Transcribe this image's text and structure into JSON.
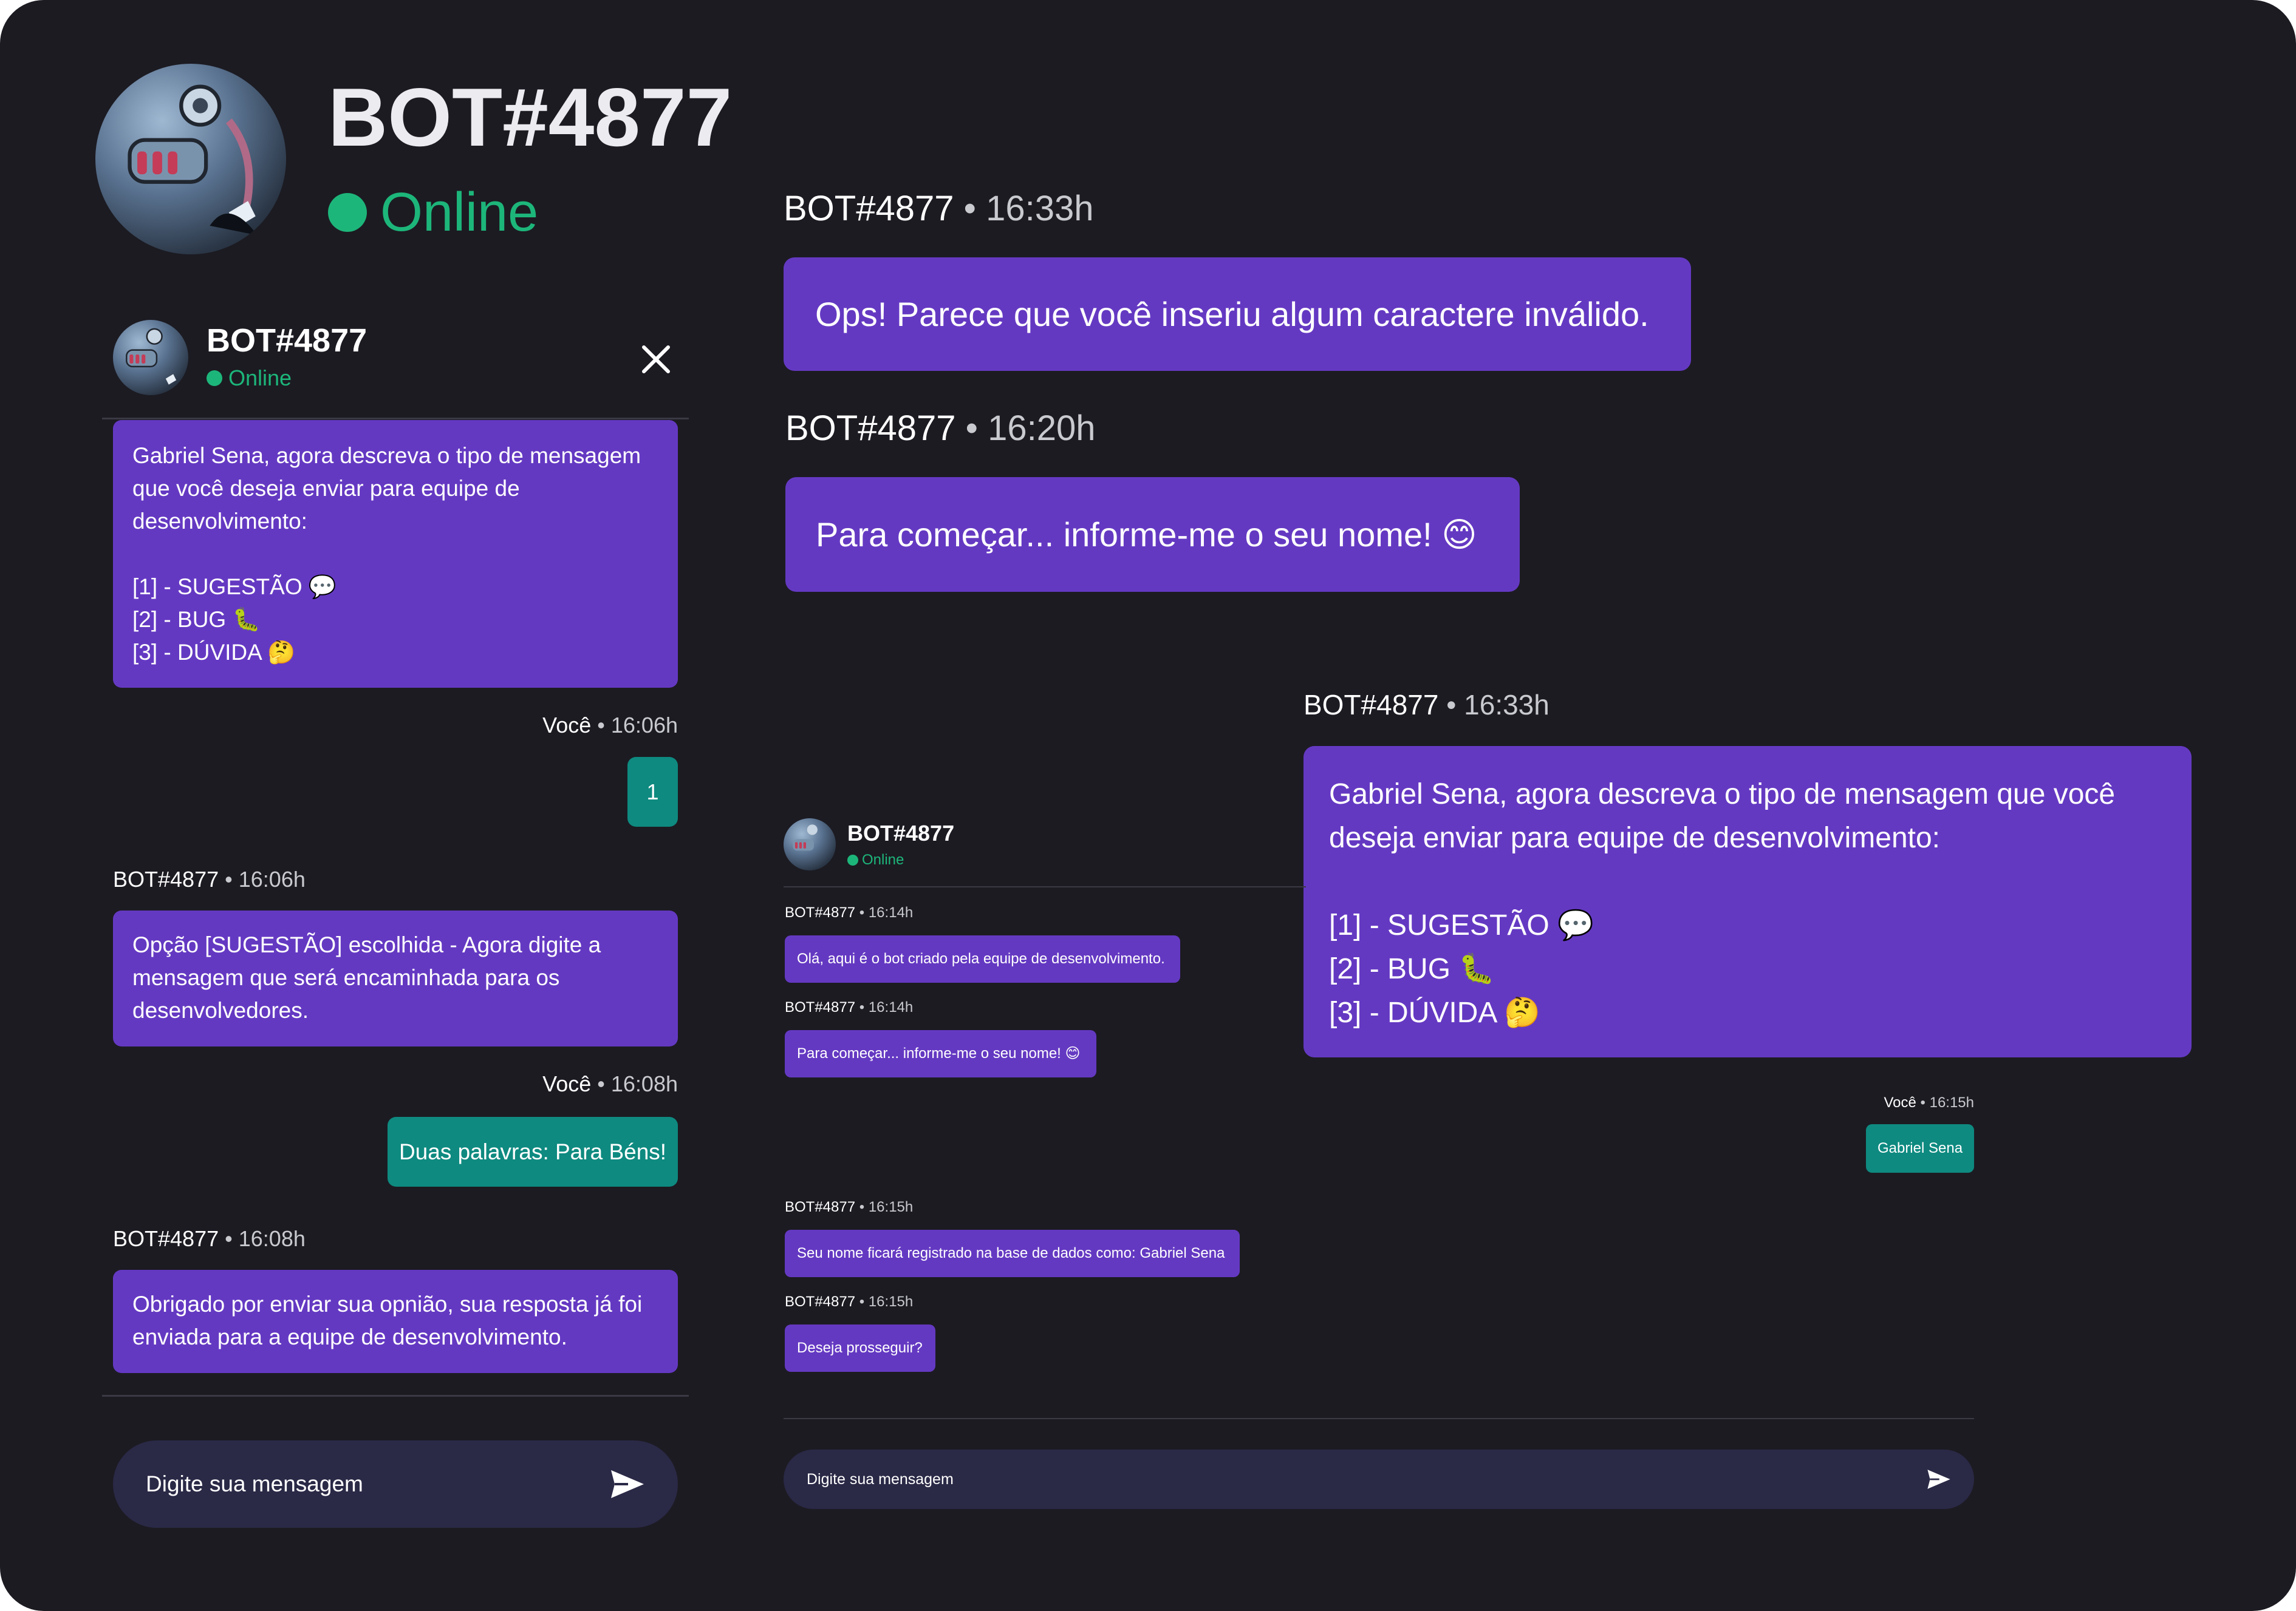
{
  "colors": {
    "background": "#1c1b22",
    "bot_bubble": "#6439c2",
    "user_bubble": "#0e8a80",
    "online": "#1db67a",
    "input": "#2a2946"
  },
  "hero": {
    "name": "BOT#4877",
    "status": "Online"
  },
  "left_chat": {
    "header": {
      "name": "BOT#4877",
      "status": "Online",
      "close_icon": "close-icon"
    },
    "messages": [
      {
        "text": "Gabriel Sena, agora descreva o tipo de mensagem que você deseja enviar para equipe de desenvolvimento:\n\n[1] - SUGESTÃO 💬\n[2] - BUG 🐛\n[3] - DÚVIDA 🤔"
      },
      {
        "sender": "Você",
        "time": "16:06h",
        "text": "1"
      },
      {
        "sender": "BOT#4877",
        "time": "16:06h",
        "text": "Opção [SUGESTÃO] escolhida - Agora digite a mensagem que será encaminhada para os desenvolvedores."
      },
      {
        "sender": "Você",
        "time": "16:08h",
        "text": "Duas palavras: Para Béns!"
      },
      {
        "sender": "BOT#4877",
        "time": "16:08h",
        "text": "Obrigado por enviar sua opnião, sua resposta já foi enviada para a equipe de desenvolvimento."
      }
    ],
    "input_placeholder": "Digite sua mensagem",
    "send_icon": "send-icon"
  },
  "showcase": [
    {
      "sender": "BOT#4877",
      "time": "16:33h",
      "text": "Ops! Parece que você inseriu algum caractere inválido."
    },
    {
      "sender": "BOT#4877",
      "time": "16:20h",
      "text": "Para começar... informe-me o seu nome! 😊"
    },
    {
      "sender": "BOT#4877",
      "time": "16:33h",
      "text": "Gabriel Sena, agora descreva o tipo de mensagem que você deseja enviar para equipe de desenvolvimento:\n\n[1] - SUGESTÃO 💬\n[2] - BUG 🐛\n[3] - DÚVIDA 🤔"
    }
  ],
  "mini_chat": {
    "header": {
      "name": "BOT#4877",
      "status": "Online"
    },
    "messages": [
      {
        "sender": "BOT#4877",
        "time": "16:14h",
        "text": "Olá, aqui é o bot criado pela equipe de desenvolvimento."
      },
      {
        "sender": "BOT#4877",
        "time": "16:14h",
        "text": "Para começar... informe-me o seu nome! 😊"
      },
      {
        "sender": "Você",
        "time": "16:15h",
        "text": "Gabriel Sena"
      },
      {
        "sender": "BOT#4877",
        "time": "16:15h",
        "text": "Seu nome ficará registrado na base de dados como: Gabriel Sena"
      },
      {
        "sender": "BOT#4877",
        "time": "16:15h",
        "text": "Deseja prosseguir?"
      }
    ],
    "input_placeholder": "Digite sua mensagem"
  },
  "separator": "•"
}
